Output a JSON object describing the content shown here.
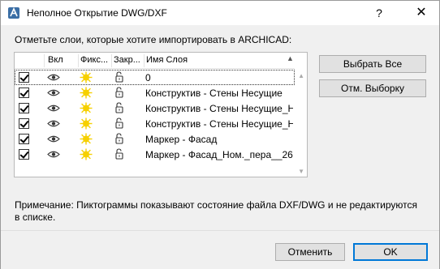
{
  "window": {
    "title": "Неполное Открытие DWG/DXF",
    "help_label": "?",
    "close_label": "✕"
  },
  "instruction": "Отметьте слои, которые хотите импортировать в ARCHICAD:",
  "columns": {
    "check": "",
    "visible": "Вкл",
    "fixed": "Фикс...",
    "locked": "Закр...",
    "name": "Имя Слоя"
  },
  "layers": [
    {
      "checked": true,
      "name": "0"
    },
    {
      "checked": true,
      "name": "Конструктив - Стены Несущие"
    },
    {
      "checked": true,
      "name": "Конструктив - Стены Несущие_Н..."
    },
    {
      "checked": true,
      "name": "Конструктив - Стены Несущие_Н..."
    },
    {
      "checked": true,
      "name": "Маркер - Фасад"
    },
    {
      "checked": true,
      "name": "Маркер - Фасад_Ном._пера__26"
    }
  ],
  "buttons": {
    "select_all": "Выбрать Все",
    "deselect": "Отм. Выборку",
    "cancel": "Отменить",
    "ok": "OK"
  },
  "note": "Примечание: Пиктограммы показывают состояние файла DXF/DWG и не редактируются в списке.",
  "icons": {
    "visible": "eye-icon",
    "fixed": "sun-icon",
    "locked": "padlock-open-icon"
  },
  "colors": {
    "sun": "#f6d000",
    "focus_border": "#0078d7"
  }
}
